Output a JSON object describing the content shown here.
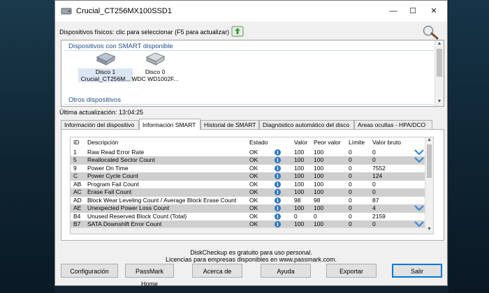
{
  "window": {
    "title": "Crucial_CT256MX100SSD1",
    "controls": {
      "minimize": "—",
      "maximize": "☐",
      "close": "✕"
    }
  },
  "physical_devices_label": "Dispositivos físicos: clic para seleccionar (F5 para actualizar)",
  "devices": {
    "smart_header": "Dispositivos con SMART disponible",
    "disks": [
      {
        "line1": "Disco 1",
        "line2": "Crucial_CT256M..."
      },
      {
        "line1": "Disco 0",
        "line2": "WDC WD1002F..."
      }
    ],
    "other_header": "Otros dispositivos"
  },
  "last_update": "Última actualización: 13:04:25",
  "tabs": [
    "Información del dispositivo",
    "Información SMART",
    "Historial de SMART",
    "Diagnóstico automático del disco",
    "Areas ocultas - HPA/DCO"
  ],
  "smart_table": {
    "columns": {
      "id": "ID",
      "desc": "Descripción",
      "estado": "Estado",
      "valor": "Valor",
      "peor": "Peor valor",
      "limite": "Límite",
      "bruto": "Valor bruto"
    },
    "rows": [
      {
        "id": "1",
        "desc": "Raw Read Error Rate",
        "estado": "OK",
        "valor": "100",
        "peor": "100",
        "limite": "0",
        "bruto": "0"
      },
      {
        "id": "5",
        "desc": "Reallocated Sector Count",
        "estado": "OK",
        "valor": "100",
        "peor": "100",
        "limite": "0",
        "bruto": "0"
      },
      {
        "id": "9",
        "desc": "Power On Time",
        "estado": "OK",
        "valor": "100",
        "peor": "100",
        "limite": "0",
        "bruto": "7552"
      },
      {
        "id": "C",
        "desc": "Power Cycle Count",
        "estado": "OK",
        "valor": "100",
        "peor": "100",
        "limite": "0",
        "bruto": "124"
      },
      {
        "id": "AB",
        "desc": "Program Fail Count",
        "estado": "OK",
        "valor": "100",
        "peor": "100",
        "limite": "0",
        "bruto": "0"
      },
      {
        "id": "AC",
        "desc": "Erase Fail Count",
        "estado": "OK",
        "valor": "100",
        "peor": "100",
        "limite": "0",
        "bruto": "0"
      },
      {
        "id": "AD",
        "desc": "Block Wear Leveling Count / Average Block Erase Count",
        "estado": "OK",
        "valor": "98",
        "peor": "98",
        "limite": "0",
        "bruto": "87"
      },
      {
        "id": "AE",
        "desc": "Unexpected Power Loss Count",
        "estado": "OK",
        "valor": "100",
        "peor": "100",
        "limite": "0",
        "bruto": "4"
      },
      {
        "id": "B4",
        "desc": "Unused Reserved Block Count (Total)",
        "estado": "OK",
        "valor": "0",
        "peor": "0",
        "limite": "0",
        "bruto": "2159"
      },
      {
        "id": "B7",
        "desc": "SATA Downshift Error Count",
        "estado": "OK",
        "valor": "100",
        "peor": "100",
        "limite": "0",
        "bruto": "0"
      }
    ]
  },
  "footer": {
    "line1": "DiskCheckup es gratuito para uso personal.",
    "line2": "Licencias para empresas disponibles en www.passmark.com."
  },
  "buttons": {
    "config": "Configuración",
    "passmark": "PassMark Home",
    "about": "Acerca de",
    "help": "Ayuda",
    "export": "Exportar",
    "exit": "Salir"
  },
  "colors": {
    "accent": "#0078d7",
    "info": "#2a76c8",
    "chevron": "#3a86d4",
    "row_shade": "#cfcfcf"
  }
}
